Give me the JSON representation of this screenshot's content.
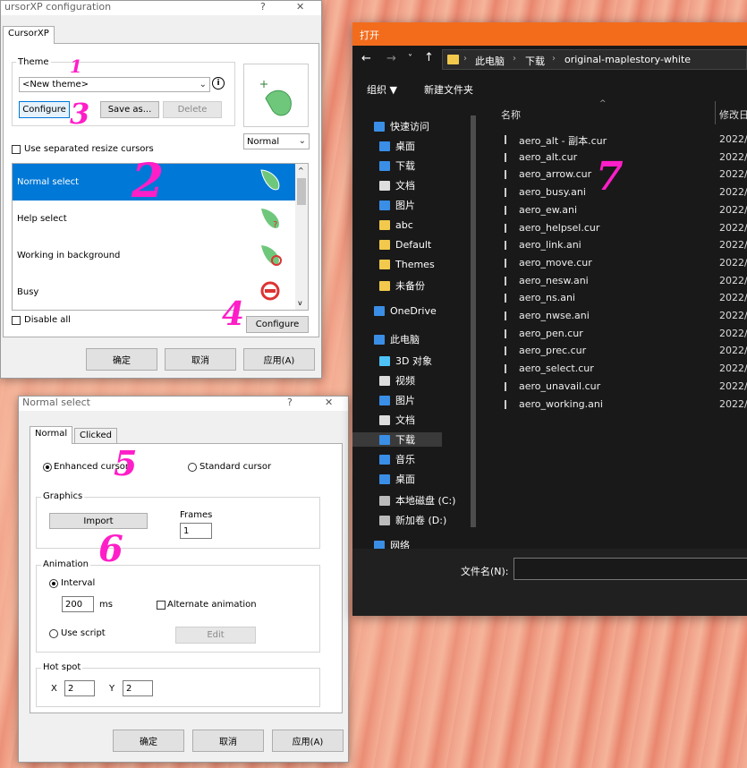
{
  "cfg": {
    "title": "ursorXP configuration",
    "help": "?",
    "close": "✕",
    "tab": "CursorXP",
    "theme_label": "Theme",
    "theme_value": "<New theme>",
    "info": "i",
    "configure": "Configure",
    "save_as": "Save as...",
    "delete": "Delete",
    "preview_mode": "Normal",
    "use_separated": "Use separated resize cursors",
    "cursor_items": [
      "Normal select",
      "Help select",
      "Working in background",
      "Busy"
    ],
    "disable_all": "Disable all",
    "configure2": "Configure",
    "ok": "确定",
    "cancel": "取消",
    "apply": "应用(A)"
  },
  "ns": {
    "title": "Normal select",
    "help": "?",
    "close": "✕",
    "tabs": [
      "Normal",
      "Clicked"
    ],
    "enhanced": "Enhanced cursor",
    "standard": "Standard cursor",
    "graphics": "Graphics",
    "import": "Import",
    "frames_label": "Frames",
    "frames_value": "1",
    "animation": "Animation",
    "interval": "Interval",
    "interval_value": "200",
    "ms": "ms",
    "alternate": "Alternate animation",
    "use_script": "Use script",
    "edit": "Edit",
    "hotspot": "Hot spot",
    "x_label": "X",
    "x_value": "2",
    "y_label": "Y",
    "y_value": "2",
    "ok": "确定",
    "cancel": "取消",
    "apply": "应用(A)"
  },
  "explorer": {
    "title": "打开",
    "breadcrumb": [
      "此电脑",
      "下载",
      "original-maplestory-white"
    ],
    "organize": "组织 ▼",
    "new_folder": "新建文件夹",
    "col_name": "名称",
    "col_date": "修改日",
    "nav": [
      {
        "label": "快速访问",
        "icon": "star-icon"
      },
      {
        "label": "桌面",
        "icon": "desktop-icon"
      },
      {
        "label": "下载",
        "icon": "download-icon"
      },
      {
        "label": "文档",
        "icon": "document-icon"
      },
      {
        "label": "图片",
        "icon": "picture-icon"
      },
      {
        "label": "abc",
        "icon": "folder-icon"
      },
      {
        "label": "Default",
        "icon": "folder-icon"
      },
      {
        "label": "Themes",
        "icon": "folder-icon"
      },
      {
        "label": "未备份",
        "icon": "folder-icon"
      },
      {
        "label": "OneDrive",
        "icon": "cloud-icon"
      },
      {
        "label": "此电脑",
        "icon": "computer-icon"
      },
      {
        "label": "3D 对象",
        "icon": "cube-icon"
      },
      {
        "label": "视频",
        "icon": "video-icon"
      },
      {
        "label": "图片",
        "icon": "picture-icon"
      },
      {
        "label": "文档",
        "icon": "document-icon"
      },
      {
        "label": "下载",
        "icon": "download-icon"
      },
      {
        "label": "音乐",
        "icon": "music-icon"
      },
      {
        "label": "桌面",
        "icon": "desktop-icon"
      },
      {
        "label": "本地磁盘 (C:)",
        "icon": "drive-icon"
      },
      {
        "label": "新加卷 (D:)",
        "icon": "drive-icon"
      },
      {
        "label": "网络",
        "icon": "network-icon"
      }
    ],
    "files": [
      "aero_alt - 副本.cur",
      "aero_alt.cur",
      "aero_arrow.cur",
      "aero_busy.ani",
      "aero_ew.ani",
      "aero_helpsel.cur",
      "aero_link.ani",
      "aero_move.cur",
      "aero_nesw.ani",
      "aero_ns.ani",
      "aero_nwse.ani",
      "aero_pen.cur",
      "aero_prec.cur",
      "aero_select.cur",
      "aero_unavail.cur",
      "aero_working.ani"
    ],
    "file_date": "2022/",
    "filename_label": "文件名(N):"
  },
  "annotations": [
    "1",
    "2",
    "3",
    "4",
    "5",
    "6",
    "7"
  ]
}
